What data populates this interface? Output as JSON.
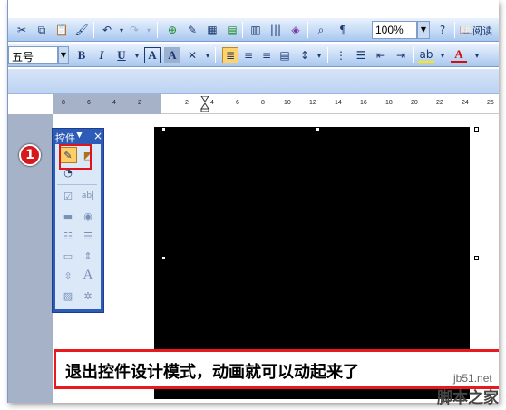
{
  "toolbar_standard": {
    "zoom_value": "100%",
    "read_label": "阅读"
  },
  "toolbar_format": {
    "font_size": "五号",
    "bold_label": "B",
    "italic_label": "I",
    "underline_label": "U",
    "char_border_label": "A",
    "char_shading_label": "A"
  },
  "ruler": {
    "ticks": [
      "8",
      "6",
      "4",
      "2",
      "2",
      "4",
      "6",
      "8",
      "10",
      "12",
      "14",
      "16",
      "18",
      "20",
      "22",
      "24",
      "26"
    ]
  },
  "control_toolbox": {
    "title": "控件",
    "close_symbol": "×"
  },
  "step_badge": "1",
  "caption": "退出控件设计模式，动画就可以动起来了",
  "watermark": {
    "site": "jb51.net",
    "name": "脚本之家"
  },
  "colors": {
    "highlight_red": "#e61a1f",
    "toolbar_blue": "#c3d9f5",
    "toolbox_blue": "#2d5cb8",
    "animation_area": "#000000"
  }
}
